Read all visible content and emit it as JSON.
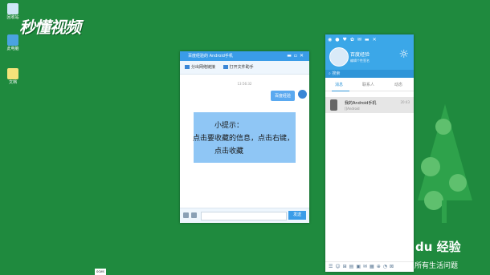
{
  "desktop": {
    "icons": [
      {
        "label": "回收站",
        "icon": "recycle-bin-icon"
      },
      {
        "label": "此电脑",
        "icon": "computer-icon"
      },
      {
        "label": "文档",
        "icon": "document-icon"
      }
    ],
    "watermark": "秒懂视频",
    "taskbar_label": "ocws"
  },
  "chat_window": {
    "title": "百度经验的 Android手机",
    "toolbar": [
      "分出网络链接",
      "打开文件助手"
    ],
    "time": "13:56:32",
    "message": "百度经验",
    "send_label": "发送"
  },
  "tip": {
    "line1": "小提示：",
    "line2": "点击要收藏的信息，点击右键，",
    "line3": "点击收藏"
  },
  "contacts_panel": {
    "user_name": "百度经验",
    "signature": "编辑个性签名",
    "search_placeholder": "搜索",
    "tabs": [
      "消息",
      "联系人",
      "动态"
    ],
    "contact": {
      "name": "我的Android手机",
      "sub": "[]Android",
      "time": "20:43"
    }
  },
  "brand": {
    "logo_text": "du 经验",
    "slogan": "所有生活问题"
  },
  "colors": {
    "desktop_bg": "#1f8a3e",
    "accent": "#3a9ce8",
    "tip_bg": "#8fc6f5"
  }
}
